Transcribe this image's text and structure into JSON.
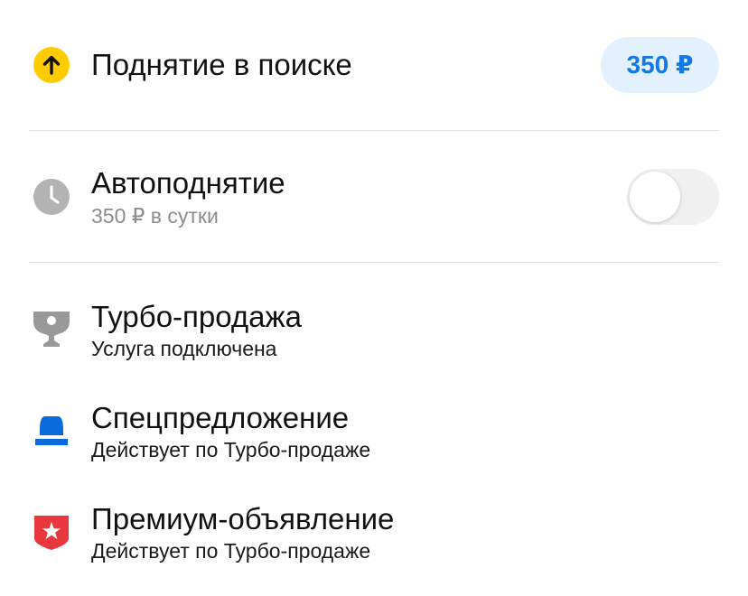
{
  "colors": {
    "accent_blue": "#1478e6",
    "pill_bg": "#e3f0fd",
    "raise_icon": "#ffcc00",
    "clock_icon": "#b3b3b3",
    "trophy_icon": "#999999",
    "special_offer_icon": "#0a6cdc",
    "premium_icon": "#e8383d",
    "divider": "#e3e3e3"
  },
  "services": {
    "raise": {
      "title": "Поднятие в поиске",
      "price": "350 ₽",
      "icon": "arrow-up-circle-icon"
    },
    "autoraise": {
      "title": "Автоподнятие",
      "subtitle": "350 ₽ в сутки",
      "icon": "clock-icon",
      "toggle_on": false
    },
    "turbo": {
      "title": "Турбо-продажа",
      "subtitle": "Услуга подключена",
      "icon": "trophy-icon"
    },
    "special": {
      "title": "Спецпредложение",
      "subtitle": "Действует по Турбо-продаже",
      "icon": "special-offer-icon"
    },
    "premium": {
      "title": "Премиум-объявление",
      "subtitle": "Действует по Турбо-продаже",
      "icon": "star-shield-icon"
    }
  }
}
